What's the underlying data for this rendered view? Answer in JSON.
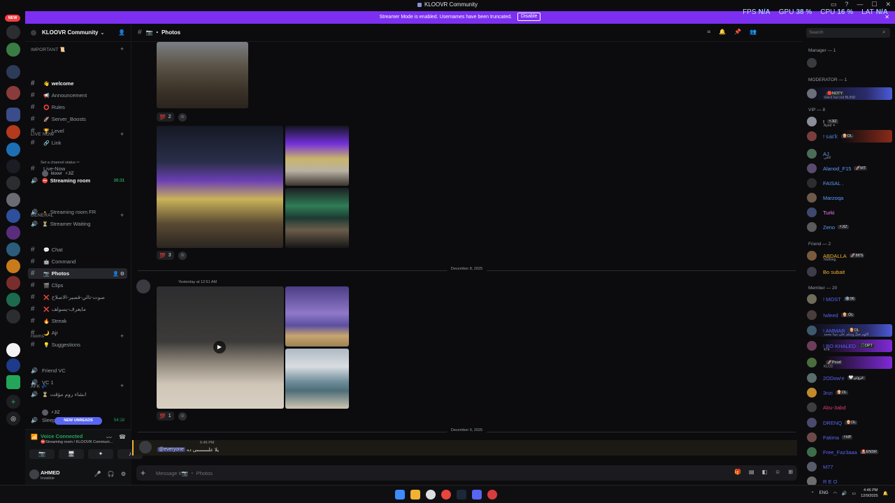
{
  "window": {
    "title": "KLOOVR Community"
  },
  "banner": {
    "text": "Streamer Mode is enabled. Usernames have been truncated.",
    "button": "Disable"
  },
  "perf": {
    "fps_label": "FPS",
    "fps_value": "N/A",
    "gpu_label": "GPU",
    "gpu_value": "38 %",
    "cpu_label": "CPU",
    "cpu_value": "16 %",
    "lat_label": "LAT",
    "lat_value": "N/A"
  },
  "rail": {
    "new_badge": "NEW"
  },
  "guild": {
    "name": "KLOOVR Community"
  },
  "categories": {
    "important": "IMPORTANT 📜",
    "live_now": "LIVE NOW",
    "general": "GENERAL",
    "rooms": "rooms",
    "afk": "AFK 💤"
  },
  "channels": [
    {
      "name": "welcome",
      "emoji": "👋",
      "type": "text",
      "bold": true
    },
    {
      "name": "Announcement",
      "emoji": "📢",
      "type": "text"
    },
    {
      "name": "Rules",
      "emoji": "⭕",
      "type": "text"
    },
    {
      "name": "Server_Boosts",
      "emoji": "🚀",
      "type": "text"
    },
    {
      "name": "Level",
      "emoji": "🏆",
      "type": "text"
    },
    {
      "name": "Link",
      "emoji": "🔗",
      "type": "text"
    },
    {
      "name": "Live-Now",
      "emoji": "",
      "type": "text"
    },
    {
      "name": "Streaming room",
      "emoji": "⛔",
      "type": "voice",
      "bold": true,
      "time": "30:31"
    },
    {
      "name": "Streaming room FR",
      "emoji": "🔸",
      "type": "voice"
    },
    {
      "name": "Streamer Waiting",
      "emoji": "⏳",
      "type": "voice"
    },
    {
      "name": "Chat",
      "emoji": "💬",
      "type": "text"
    },
    {
      "name": "Command",
      "emoji": "🤖",
      "type": "text"
    },
    {
      "name": "Photos",
      "emoji": "📷",
      "type": "text",
      "selected": true
    },
    {
      "name": "Clips",
      "emoji": "🎬",
      "type": "text"
    },
    {
      "name": "صوت-تالي-قصير-الاصلاح",
      "emoji": "❌",
      "type": "text"
    },
    {
      "name": "مايعرف-يسولف",
      "emoji": "❌",
      "type": "text"
    },
    {
      "name": "Streak",
      "emoji": "🔥",
      "type": "text"
    },
    {
      "name": "Ajr",
      "emoji": "🌙",
      "type": "text"
    },
    {
      "name": "Suggestions",
      "emoji": "💡",
      "type": "text"
    },
    {
      "name": "Friend VC",
      "emoji": "",
      "type": "voice"
    },
    {
      "name": "VC 1",
      "emoji": "",
      "type": "voice"
    },
    {
      "name": "انشاء روم مؤقت",
      "emoji": "⏳",
      "type": "voice"
    },
    {
      "name": "Sleep & Busy",
      "emoji": "",
      "type": "voice",
      "time": "54:18"
    }
  ],
  "streaming_sub": "Set a channel status ✏",
  "voice_users": {
    "streaming": "kloovr",
    "streaming_tag": "⚡JIZ",
    "afk_tag": "⚡JIZ"
  },
  "new_unreads": "NEW UNREADS",
  "voice": {
    "title": "Voice Connected",
    "subtitle": "⛔Streaming room / KLOOVR Communi..."
  },
  "user": {
    "name": "AHMED",
    "status": "Invisible"
  },
  "header": {
    "channel": "📷 ・ Photos"
  },
  "search": {
    "placeholder": "Search"
  },
  "chat": {
    "reactions": [
      {
        "emoji": "💯",
        "count": "2"
      },
      {
        "emoji": "💯",
        "count": "3"
      },
      {
        "emoji": "💯",
        "count": "1"
      }
    ],
    "divider1": "December 8, 2025",
    "msg_time": "Yesterday at 12:51 AM",
    "divider2": "December 9, 2025",
    "mention_time": "6:46 PM",
    "mention": "@everyone",
    "mention_text": "يلا علىىىىىىىىى ده"
  },
  "composer": {
    "placeholder": "Message #📷 ・ Photos"
  },
  "member_groups": {
    "manager": "Manager — 1",
    "moderator": "MODERATOR — 1",
    "vip": "VIP — 8",
    "friend": "Friend — 2",
    "member": "Member — 20"
  },
  "members": [
    {
      "name": "",
      "color": "#dbdee1"
    },
    {
      "name": "",
      "tag": "🔴NOTY",
      "sub": "Silent but not BLIND",
      "color": "#dbdee1"
    },
    {
      "name": "!",
      "tag": "⚡JIZ",
      "sub": "Ayed ✶",
      "color": "#f2f3f5"
    },
    {
      "name": "! 𝕤𝕒𝕣𝕜",
      "tag": "🍿OL",
      "color": "#5b9bff"
    },
    {
      "name": "AJ",
      "sub": "كافي",
      "color": "#5b9bff"
    },
    {
      "name": "Alanod_F15",
      "tag": "🚀MT",
      "color": "#5b9bff"
    },
    {
      "name": "FAISAL .",
      "color": "#5b9bff"
    },
    {
      "name": "Marzoqa",
      "color": "#5b9bff"
    },
    {
      "name": "Turki",
      "color": "#f47fff"
    },
    {
      "name": "Zeno",
      "tag": "⚡JIZ",
      "color": "#5b9bff"
    },
    {
      "name": "ABDALLA",
      "tag": "🚀88'S",
      "sub": "Nothing.",
      "color": "#f0b232"
    },
    {
      "name": "Bo subait",
      "color": "#f0b232"
    },
    {
      "name": "! MOST",
      "tag": "❄️96",
      "color": "#5865f2"
    },
    {
      "name": "!wleed",
      "tag": "🍿 ÓL",
      "color": "#5865f2"
    },
    {
      "name": "! AMMAR",
      "tag": "🍿OL",
      "sub": "اللهم صلِّ وسلم على نبينا محمد",
      "color": "#5865f2"
    },
    {
      "name": "! BO KHALED",
      "tag": "🎵DPT",
      "sub": "474",
      "color": "#5865f2"
    },
    {
      "name": "",
      "tag": "🚀Poud",
      "sub": "KLO3",
      "color": "#dbdee1"
    },
    {
      "name": "2ODow'e",
      "tag": "🤍عزوتي",
      "color": "#5865f2"
    },
    {
      "name": "3nzi",
      "tag": "🍿OL",
      "color": "#5865f2"
    },
    {
      "name": "Abu-3abd",
      "color": "#d83c6e"
    },
    {
      "name": "DRENQ",
      "tag": "🍿OL",
      "color": "#5865f2"
    },
    {
      "name": "Fatima",
      "tag": "⚡HP",
      "color": "#5865f2"
    },
    {
      "name": "Free_Faz3aaa",
      "tag": "🚨ENSR",
      "color": "#5865f2"
    },
    {
      "name": "M77",
      "color": "#5865f2"
    },
    {
      "name": "R E O",
      "color": "#5865f2"
    }
  ],
  "taskbar": {
    "lang": "ENG",
    "time": "4:46 PM",
    "date": "12/9/2025"
  }
}
